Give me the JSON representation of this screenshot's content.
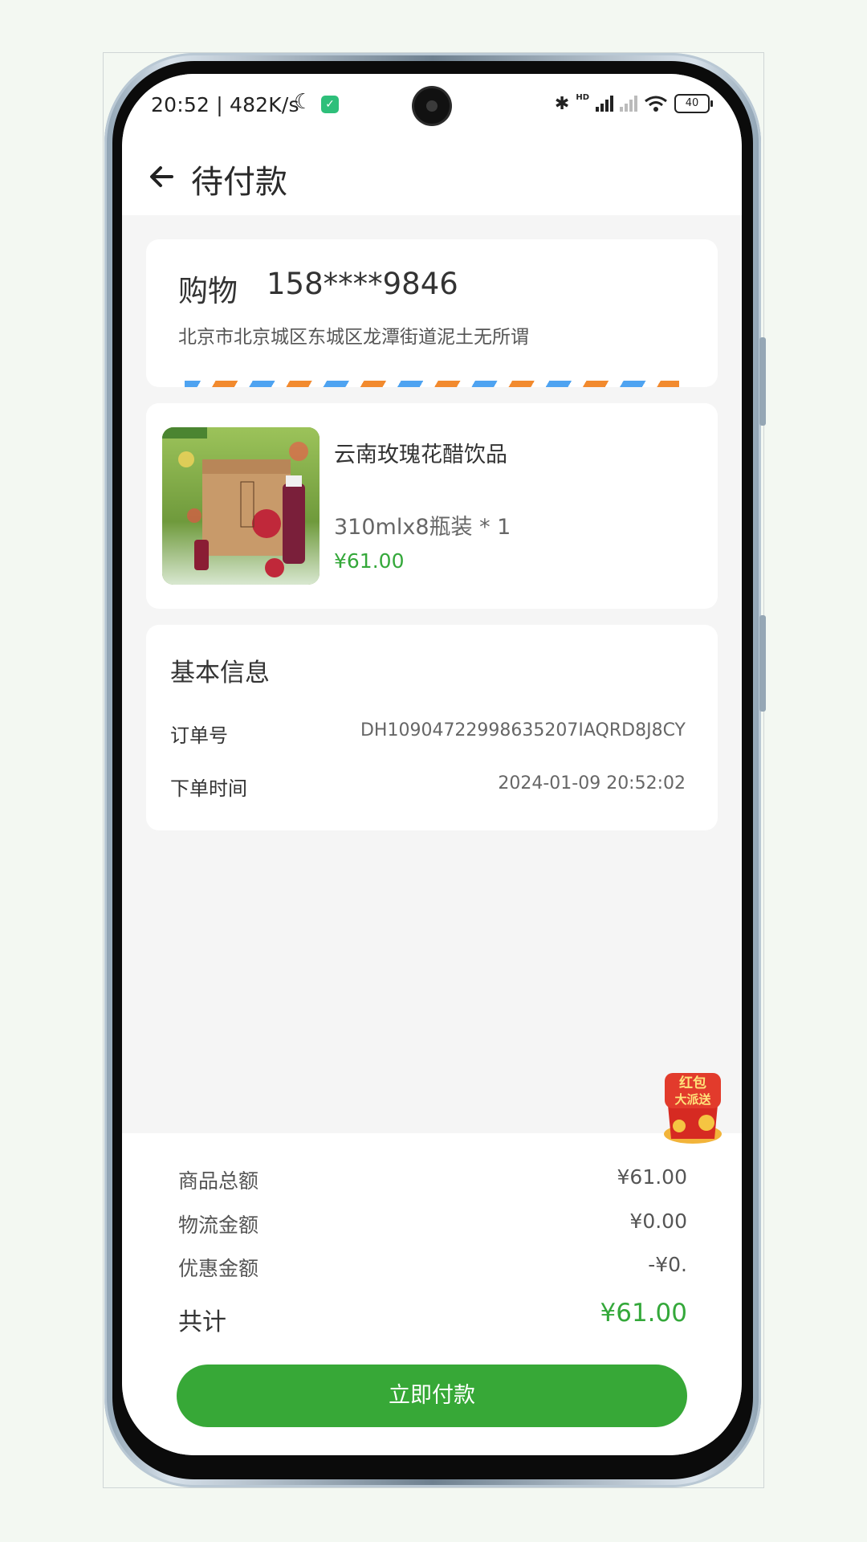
{
  "status_bar": {
    "time_speed": "20:52 | 482K/s",
    "battery": "40",
    "signal_label": "HD"
  },
  "header": {
    "title": "待付款"
  },
  "address": {
    "name": "购物",
    "phone": "158****9846",
    "detail": "北京市北京城区东城区龙潭街道泥土无所谓"
  },
  "product": {
    "name": "云南玫瑰花醋饮品",
    "spec": "310mlx8瓶装 * 1",
    "price": "¥61.00",
    "image_text": "玫瑰花醋"
  },
  "info": {
    "title": "基本信息",
    "order_no_label": "订单号",
    "order_no": "DH10904722998635207IAQRD8J8CY",
    "time_label": "下单时间",
    "time": "2024-01-09 20:52:02"
  },
  "summary": {
    "goods_label": "商品总额",
    "goods_value": "¥61.00",
    "shipping_label": "物流金额",
    "shipping_value": "¥0.00",
    "discount_label": "优惠金额",
    "discount_value": "-¥0.",
    "total_label": "共计",
    "total_value": "¥61.00",
    "pay_button": "立即付款"
  },
  "promo": {
    "line1": "红包",
    "line2": "大派送"
  },
  "colors": {
    "accent": "#37a837",
    "price_green": "#34a83a"
  }
}
